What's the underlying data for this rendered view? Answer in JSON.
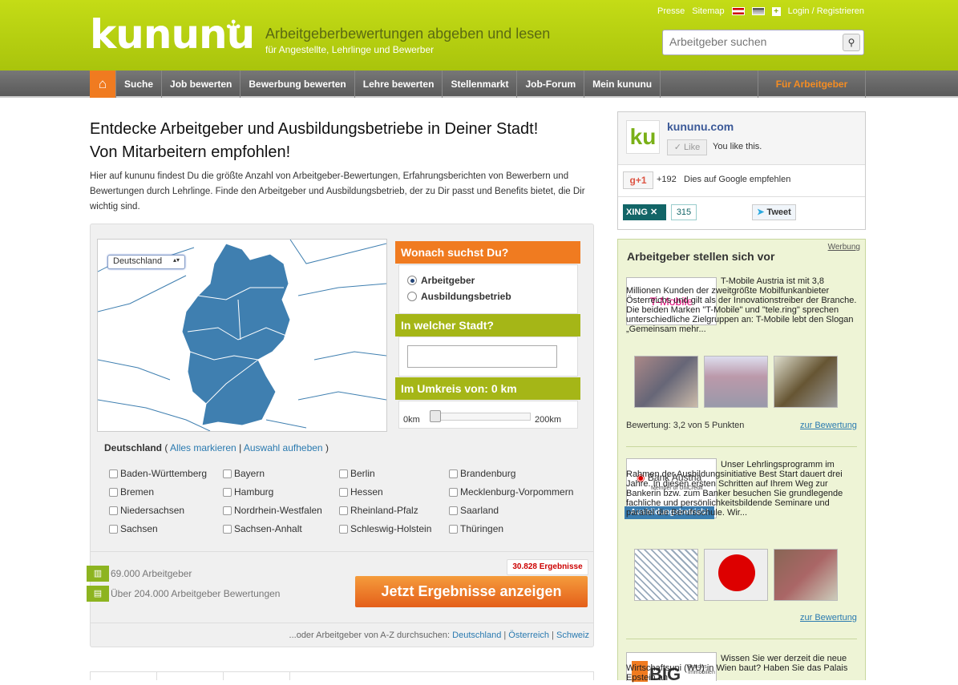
{
  "header": {
    "logo": "kununu",
    "tagline": "Arbeitgeberbewertungen abgeben und lesen",
    "subtagline": "für Angestellte, Lehrlinge und Bewerber",
    "links": [
      "Presse",
      "Sitemap"
    ],
    "login": "Login / Registrieren",
    "search_placeholder": "Arbeitgeber suchen"
  },
  "nav": {
    "items": [
      "Suche",
      "Job bewerten",
      "Bewerbung bewerten",
      "Lehre bewerten",
      "Stellenmarkt",
      "Job-Forum",
      "Mein kununu"
    ],
    "employer": "Für Arbeitgeber"
  },
  "main": {
    "h1_line1": "Entdecke Arbeitgeber und Ausbildungsbetriebe in Deiner Stadt!",
    "h1_line2": "Von Mitarbeitern empfohlen!",
    "intro": "Hier auf kununu findest Du die größte Anzahl von Arbeitgeber-Bewertungen, Erfahrungsberichten von Bewerbern und Bewertungen durch Lehrlinge. Finde den Arbeitgeber und Ausbildungsbetrieb, der zu Dir passt und Benefits bietet, die Dir wichtig sind."
  },
  "search": {
    "country_select": "Deutschland",
    "what_title": "Wonach suchst Du?",
    "options": [
      "Arbeitgeber",
      "Ausbildungsbetrieb"
    ],
    "selected_option": "Arbeitgeber",
    "city_title": "In welcher Stadt?",
    "radius_title": "Im Umkreis von: 0 km",
    "radius_min": "0km",
    "radius_max": "200km",
    "radius_value": 0
  },
  "states": {
    "title": "Deutschland",
    "mark_all": "Alles markieren",
    "clear": "Auswahl aufheben",
    "list": [
      "Baden-Württemberg",
      "Bayern",
      "Berlin",
      "Brandenburg",
      "Bremen",
      "Hamburg",
      "Hessen",
      "Mecklenburg-Vorpommern",
      "Niedersachsen",
      "Nordrhein-Westfalen",
      "Rheinland-Pfalz",
      "Saarland",
      "Sachsen",
      "Sachsen-Anhalt",
      "Schleswig-Holstein",
      "Thüringen"
    ]
  },
  "results": {
    "count": "30.828 Ergebnisse",
    "button": "Jetzt Ergebnisse anzeigen",
    "stat1": "69.000 Arbeitgeber",
    "stat2": "Über 204.000 Arbeitgeber Bewertungen",
    "az_text": "...oder Arbeitgeber von A-Z durchsuchen:",
    "az_links": [
      "Deutschland",
      "Österreich",
      "Schweiz"
    ]
  },
  "social": {
    "fb_name": "kununu.com",
    "fb_like": "Like",
    "fb_text": "You like this.",
    "gplus": "+1",
    "gplus_count": "+192",
    "gplus_text": "Dies auf Google empfehlen",
    "xing": "XING",
    "xing_count": "315",
    "tweet": "Tweet"
  },
  "sidebar": {
    "werbung": "Werbung",
    "title": "Arbeitgeber stellen sich vor",
    "ad1": {
      "logo": "T-Mobile",
      "text": "T-Mobile Austria ist mit 3,8 Millionen Kunden der zweitgrößte Mobilfunkanbieter Österreichs und gilt als der Innovationstreiber der Branche. Die beiden Marken \"T-Mobile\" und \"tele.ring\" sprechen unterschiedliche Zielgruppen an: T-Mobile lebt den Slogan „Gemeinsam mehr...",
      "rating": "Bewertung: 3,2 von 5 Punkten",
      "link": "zur Bewertung"
    },
    "ad2": {
      "logo": "Bank Austria",
      "logo_sub": "Member of UniCredit",
      "badge": "Ausbildungsbetrieb!",
      "text": "Unser Lehrlingsprogramm im Rahmen der Ausbildungsinitiative Best Start dauert drei Jahre. In diesen ersten Schritten auf Ihrem Weg zur Bankerin bzw. zum Banker besuchen Sie grundlegende fachliche und persönlichkeitsbildende Seminare und parallel die Berufsschule. Wir...",
      "link": "zur Bewertung"
    },
    "ad3": {
      "logo": "BIG",
      "logo_sub": "Bundes Immobilien",
      "text": "Wissen Sie wer derzeit die neue Wirtschaftsuni (WU) in Wien baut? Haben Sie das Palais Epstein an"
    }
  },
  "colors": {
    "brand_green": "#a9c40c",
    "orange": "#f07b20",
    "nav_gray": "#666666",
    "map_blue": "#3f7fb0"
  }
}
